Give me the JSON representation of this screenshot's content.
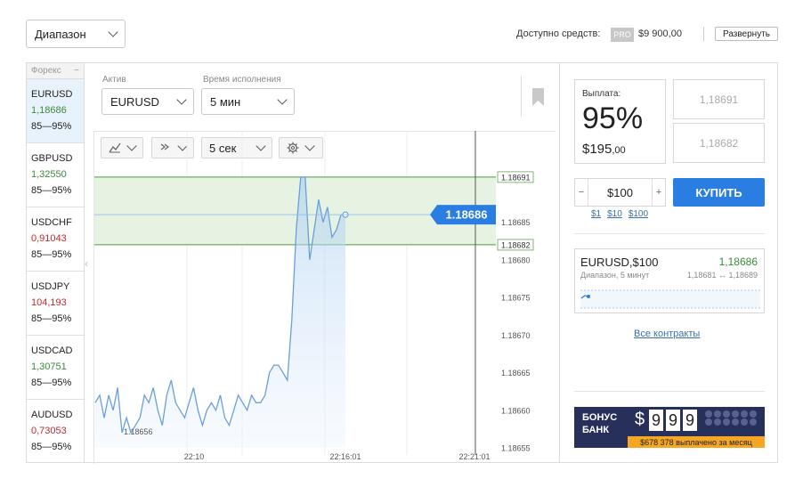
{
  "top": {
    "mode_select": "Диапазон",
    "funds_label": "Доступно средств:",
    "pro_badge": "PRO",
    "funds_value": "$9 900,00",
    "expand_button": "Развернуть"
  },
  "sidebar": {
    "header": "Форекс",
    "collapse": "−",
    "items": [
      {
        "symbol": "EURUSD",
        "price": "1,18686",
        "range": "85—95%",
        "trend": "up"
      },
      {
        "symbol": "GBPUSD",
        "price": "1,32550",
        "range": "85—95%",
        "trend": "up"
      },
      {
        "symbol": "USDCHF",
        "price": "0,91043",
        "range": "85—95%",
        "trend": "down"
      },
      {
        "symbol": "USDJPY",
        "price": "104,193",
        "range": "85—95%",
        "trend": "down"
      },
      {
        "symbol": "USDCAD",
        "price": "1,30751",
        "range": "85—95%",
        "trend": "up"
      },
      {
        "symbol": "AUDUSD",
        "price": "0,73053",
        "range": "85—95%",
        "trend": "down"
      }
    ]
  },
  "controls": {
    "asset_label": "Актив",
    "asset_value": "EURUSD",
    "time_label": "Время исполнения",
    "time_value": "5 мин",
    "interval": "5 сек",
    "line_icon": "line-chart-icon",
    "indicator_icon": "indicators-icon",
    "settings_icon": "gear-icon",
    "bookmark_icon": "bookmark-icon"
  },
  "chart": {
    "current_price": "1.18686",
    "upper_bound": "1.18691",
    "lower_bound": "1.18682",
    "min_label": "1.18656",
    "y_ticks": [
      "1.18685",
      "1.18680",
      "1.18675",
      "1.18670",
      "1.18665",
      "1.18660",
      "1.18655"
    ],
    "x_ticks": [
      "22:10",
      "22:16:01",
      "22:21:01"
    ],
    "line_color": "#6a9fd8",
    "band_color": "#e6f3e2"
  },
  "chart_data": {
    "type": "line",
    "series": [
      {
        "values": [
          1.18661,
          1.18662,
          1.18659,
          1.18662,
          1.1866,
          1.18663,
          1.18657,
          1.18659,
          1.18657,
          1.18658,
          1.18659,
          1.18662,
          1.18661,
          1.18663,
          1.1866,
          1.18658,
          1.18662,
          1.18664,
          1.18661,
          1.1866,
          1.18659,
          1.18661,
          1.18663,
          1.1866,
          1.18658,
          1.1866,
          1.18661,
          1.1866,
          1.18662,
          1.18659,
          1.18658,
          1.1866,
          1.18662,
          1.18661,
          1.1866,
          1.18662,
          1.18661,
          1.18661,
          1.18662,
          1.18665,
          1.18666,
          1.18666,
          1.18665,
          1.18664,
          1.18672,
          1.18684,
          1.18691,
          1.18691,
          1.1868,
          1.18684,
          1.18688,
          1.18685,
          1.18687,
          1.18683,
          1.18684,
          1.18686,
          1.18686
        ]
      }
    ],
    "y_ticks": [
      1.18685,
      1.1868,
      1.18675,
      1.1867,
      1.18665,
      1.1866,
      1.18655
    ],
    "x_ticks": [
      "22:10",
      "22:16:01",
      "22:21:01"
    ]
  },
  "panel": {
    "payout_label": "Выплата:",
    "payout_percent": "95%",
    "payout_amount_main": "$195",
    "payout_amount_cents": ",00",
    "upper_price": "1,18691",
    "lower_price": "1,18682",
    "minus": "−",
    "amount": "$100",
    "plus": "+",
    "quick1": "$1",
    "quick2": "$10",
    "quick3": "$100",
    "buy_button": "КУПИТЬ",
    "contract_title": "EURUSD,$100",
    "contract_price": "1,18686",
    "contract_sub": "Диапазон, 5 минут",
    "contract_range": "1,18681 ↔ 1,18689",
    "all_contracts": "Все контракты",
    "accent": "#2a7de1"
  },
  "banner": {
    "title1": "БОНУС",
    "title2": "БАНК",
    "currency": "$",
    "digits": [
      "9",
      "9",
      "9"
    ],
    "caption": "$678 378 выплачено за месяц",
    "accent": "#f5a623"
  }
}
